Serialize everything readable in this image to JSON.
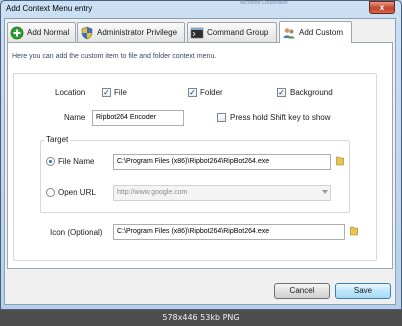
{
  "window": {
    "title": "Add Context Menu entry",
    "faint_text": "Microsoft Corporation",
    "close_glyph": "x"
  },
  "tabs": [
    {
      "label": "Add Normal",
      "icon": "plus-circle-icon",
      "active": false
    },
    {
      "label": "Administrator Privilege",
      "icon": "shield-icon",
      "active": false
    },
    {
      "label": "Command Group",
      "icon": "console-icon",
      "active": false
    },
    {
      "label": "Add Custom",
      "icon": "users-icon",
      "active": true
    }
  ],
  "pane": {
    "description": "Here you can add the custom item to file and folder context menu."
  },
  "location": {
    "label": "Location",
    "options": [
      {
        "label": "File",
        "checked": true
      },
      {
        "label": "Folder",
        "checked": true
      },
      {
        "label": "Background",
        "checked": true
      }
    ]
  },
  "name": {
    "label": "Name",
    "value": "Ripbot264 Encoder",
    "shift_label": "Press hold Shift key to show",
    "shift_checked": false
  },
  "target": {
    "group_label": "Target",
    "file_name_label": "File Name",
    "file_name_value": "C:\\Program Files (x86)\\Ripbot264\\RipBot264.exe",
    "file_selected": true,
    "url_label": "Open URL",
    "url_value": "http://www.google.com"
  },
  "icon": {
    "label": "Icon (Optional)",
    "value": "C:\\Program Files (x86)\\Ripbot264\\RipBot264.exe"
  },
  "buttons": {
    "cancel": "Cancel",
    "save": "Save"
  },
  "footer": "578x446  53kb  PNG",
  "check_glyph": "✓"
}
